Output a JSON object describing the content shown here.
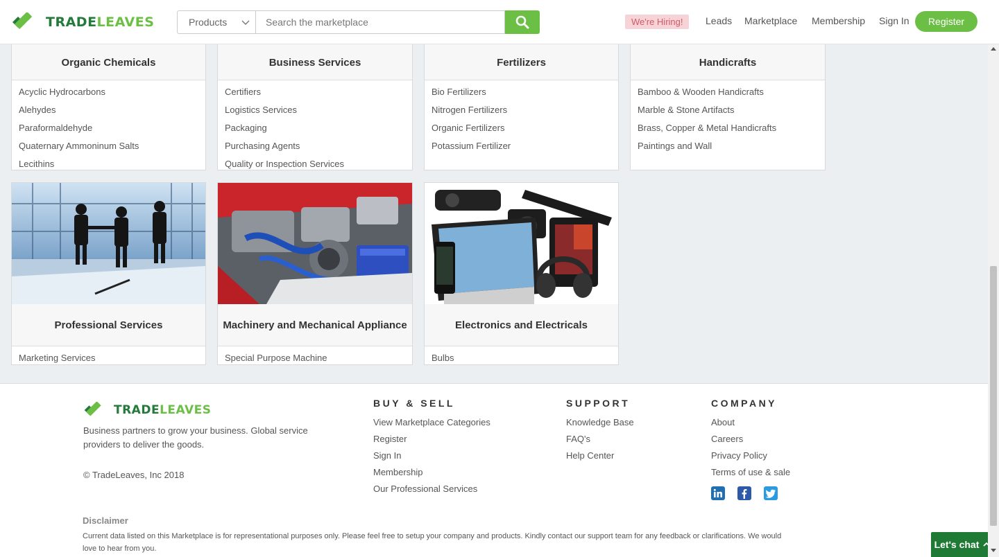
{
  "header": {
    "brand_part1": "TRADE",
    "brand_part2": "LEAVES",
    "search": {
      "category": "Products",
      "placeholder": "Search the marketplace"
    },
    "hiring": "We're Hiring!",
    "nav": [
      "Leads",
      "Marketplace",
      "Membership",
      "Sign In"
    ],
    "register": "Register"
  },
  "categories_top": [
    {
      "title": "Organic Chemicals",
      "items": [
        "Acyclic Hydrocarbons",
        "Alehydes",
        "Paraformaldehyde",
        "Quaternary Ammoninum Salts",
        "Lecithins"
      ]
    },
    {
      "title": "Business Services",
      "items": [
        "Certifiers",
        "Logistics Services",
        "Packaging",
        "Purchasing Agents",
        "Quality or Inspection Services"
      ]
    },
    {
      "title": "Fertilizers",
      "items": [
        "Bio Fertilizers",
        "Nitrogen Fertilizers",
        "Organic Fertilizers",
        "Potassium Fertilizer"
      ]
    },
    {
      "title": "Handicrafts",
      "items": [
        "Bamboo & Wooden Handicrafts",
        "Marble & Stone Artifacts",
        "Brass, Copper & Metal Handicrafts",
        "Paintings and Wall"
      ]
    }
  ],
  "categories_bottom": [
    {
      "title": "Professional Services",
      "items": [
        "Marketing Services"
      ],
      "image": "business-people-handshake"
    },
    {
      "title": "Machinery and Mechanical Appliance",
      "items": [
        "Special Purpose Machine"
      ],
      "image": "car-engine"
    },
    {
      "title": "Electronics and Electricals",
      "items": [
        "Bulbs"
      ],
      "image": "electronic-devices"
    }
  ],
  "footer": {
    "brand_part1": "TRADE",
    "brand_part2": "LEAVES",
    "tagline": "Business partners to grow your business. Global service providers to deliver the goods.",
    "copyright": "© TradeLeaves, Inc 2018",
    "buy_sell": {
      "title": "BUY & SELL",
      "links": [
        "View Marketplace Categories",
        "Register",
        "Sign In",
        "Membership",
        "Our Professional Services"
      ]
    },
    "support": {
      "title": "SUPPORT",
      "links": [
        "Knowledge Base",
        "FAQ's",
        "Help Center"
      ]
    },
    "company": {
      "title": "COMPANY",
      "links": [
        "About",
        "Careers",
        "Privacy Policy",
        "Terms of use & sale"
      ]
    },
    "social": [
      "linkedin-icon",
      "facebook-icon",
      "twitter-icon"
    ],
    "disclaimer_title": "Disclaimer",
    "disclaimer_text": "Current data listed on this Marketplace is for representational purposes only. Please feel free to setup your company and products. Kindly contact our support team for any feedback or clarifications. We would love to hear from you."
  },
  "chat": "Let's chat",
  "colors": {
    "brand_green": "#6cbf45",
    "brand_dark": "#237a3a",
    "chat_bg": "#1f7a35",
    "hiring_bg": "#f5d3d6"
  }
}
